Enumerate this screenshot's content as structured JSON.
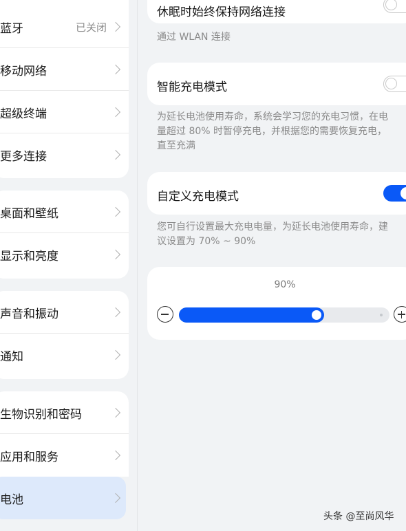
{
  "sidebar": {
    "groups": [
      {
        "items": [
          {
            "label": "蓝牙",
            "value": "已关闭"
          },
          {
            "label": "移动网络"
          },
          {
            "label": "超级终端"
          },
          {
            "label": "更多连接"
          }
        ]
      },
      {
        "items": [
          {
            "label": "桌面和壁纸"
          },
          {
            "label": "显示和亮度"
          }
        ]
      },
      {
        "items": [
          {
            "label": "声音和振动"
          },
          {
            "label": "通知"
          }
        ]
      },
      {
        "items": [
          {
            "label": "生物识别和密码"
          },
          {
            "label": "应用和服务"
          },
          {
            "label": "电池",
            "selected": true
          }
        ]
      }
    ]
  },
  "detail": {
    "sleep_network": {
      "label": "休眠时始终保持网络连接",
      "enabled": false
    },
    "wlan_note": "通过 WLAN 连接",
    "smart_charge": {
      "label": "智能充电模式",
      "enabled": false,
      "desc_lines": [
        "为延长电池使用寿命，系统会学习您的充电习惯，在电",
        "量超过 80% 时暂停充电，并根据您的需要恢复充电，",
        "直至充满"
      ]
    },
    "custom_charge": {
      "label": "自定义充电模式",
      "enabled": true,
      "desc_lines": [
        "您可自行设置最大充电电量，为延长电池使用寿命，建",
        "议设置为 70% ~ 90%"
      ]
    },
    "charge_limit": {
      "value_text": "90%",
      "fraction": 0.69
    }
  },
  "watermark": "头条 @至尚风华",
  "colors": {
    "accent": "#0a59f7",
    "background": "#f1f3f5",
    "card": "#ffffff",
    "selected_bg": "#dde9fb"
  },
  "icons": [
    "chevron-right-icon",
    "minus-circle-icon",
    "plus-circle-icon"
  ]
}
